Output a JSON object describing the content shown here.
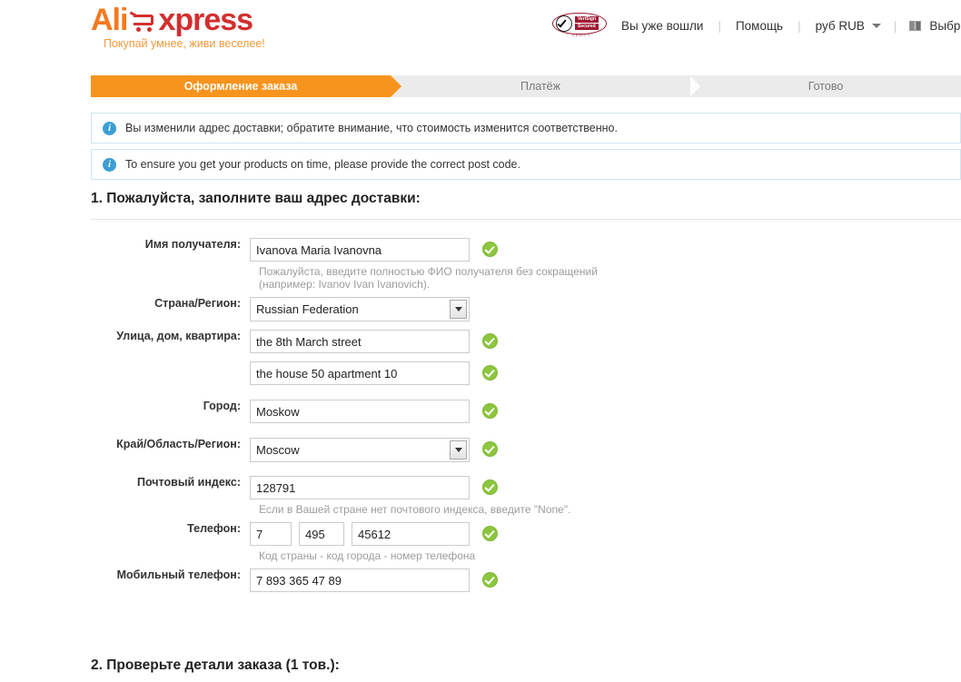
{
  "header": {
    "logo": {
      "part1": "Ali",
      "part2": "xpress",
      "cart_icon": "shopping-cart-icon"
    },
    "slogan": "Покупай умнее, живи веселее!",
    "trust_badge": {
      "icon": "verisign-secured-badge",
      "line1": "VeriSign",
      "line2": "Secured",
      "sub": "VERIFY"
    },
    "nav": [
      {
        "label": "Вы уже вошли",
        "name": "signed-in-link"
      },
      {
        "label": "Помощь",
        "name": "help-link"
      },
      {
        "label": "руб RUB",
        "name": "currency-selector"
      },
      {
        "label": "Выбрать язы",
        "name": "language-selector"
      }
    ],
    "separator": "|"
  },
  "steps": [
    {
      "label": "Оформление заказа",
      "active": true
    },
    {
      "label": "Платёж",
      "active": false
    },
    {
      "label": "Готово",
      "active": false
    }
  ],
  "alerts": [
    {
      "icon": "info-icon",
      "text": "Вы изменили адрес доставки; обратите внимание, что стоимость изменится соответственно."
    },
    {
      "icon": "info-icon",
      "text": "To ensure you get your products on time, please provide the correct post code."
    }
  ],
  "section1": {
    "title": "1. Пожалуйста, заполните ваш адрес доставки:",
    "fields": {
      "recipient_label": "Имя получателя:",
      "recipient_value": "Ivanova Maria Ivanovna",
      "recipient_hint": "Пожалуйста, введите полностью ФИО получателя без сокращений (например: Ivanov Ivan Ivanovich).",
      "country_label": "Страна/Регион:",
      "country_value": "Russian Federation",
      "street_label": "Улица, дом, квартира:",
      "street_value": "the 8th March street",
      "street2_value": "the house 50 apartment 10",
      "city_label": "Город:",
      "city_value": "Moskow",
      "region_label": "Край/Область/Регион:",
      "region_value": "Moscow",
      "zip_label": "Почтовый индекс:",
      "zip_value": "128791",
      "zip_hint": "Если в Вашей стране нет почтового индекса, введите \"None\".",
      "phone_label": "Телефон:",
      "phone_country": "7",
      "phone_area": "495",
      "phone_number": "45612",
      "phone_hint": "Код страны - код города - номер телефона",
      "mobile_label": "Мобильный телефон:",
      "mobile_value": "7 893 365 47 89"
    }
  },
  "section2": {
    "title": "2. Проверьте детали заказа (1 тов.):"
  },
  "colors": {
    "brand_orange": "#f57a1f",
    "brand_red": "#d32f2f",
    "step_active": "#f7941e",
    "valid_green": "#8cc63e",
    "info_blue": "#3b9fd4"
  }
}
